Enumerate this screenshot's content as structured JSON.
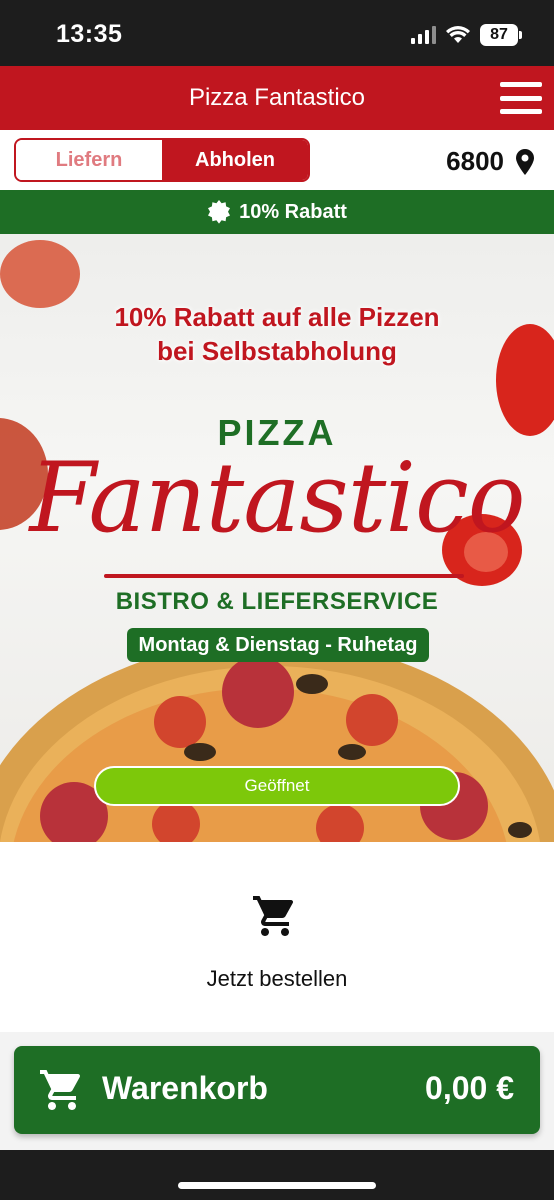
{
  "status_bar": {
    "time": "13:35",
    "battery": "87"
  },
  "header": {
    "title": "Pizza Fantastico"
  },
  "mode_toggle": {
    "deliver_label": "Liefern",
    "pickup_label": "Abholen",
    "selected": "Abholen"
  },
  "location": {
    "postcode": "6800"
  },
  "discount_banner": {
    "text": "10% Rabatt"
  },
  "hero": {
    "promo_line1": "10% Rabatt auf alle Pizzen",
    "promo_line2": "bei Selbstabholung",
    "brand_small": "PIZZA",
    "brand_script": "Fantastico",
    "brand_sub": "BISTRO & LIEFERSERVICE",
    "closing_days": "Montag & Dienstag - Ruhetag",
    "open_status": "Geöffnet"
  },
  "order": {
    "label": "Jetzt bestellen"
  },
  "cart": {
    "label": "Warenkorb",
    "total": "0,00 €"
  },
  "colors": {
    "brand_red": "#c0161f",
    "brand_green": "#1e6e25",
    "open_green": "#7dc80a"
  },
  "icons": [
    "menu-icon",
    "location-pin-icon",
    "badge-icon",
    "cart-icon",
    "signal-icon",
    "wifi-icon",
    "battery-icon"
  ]
}
